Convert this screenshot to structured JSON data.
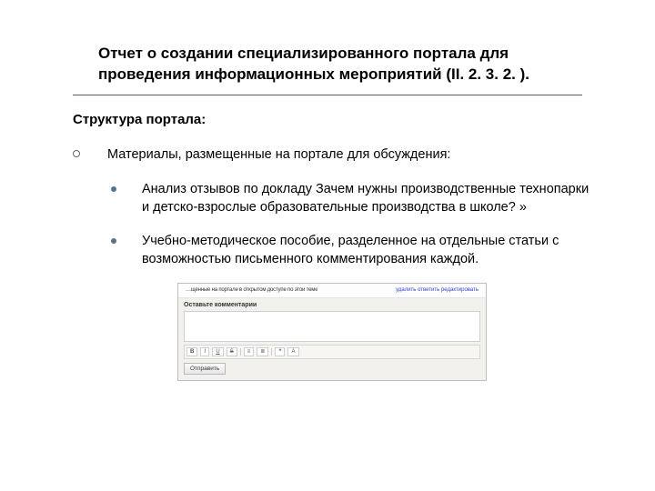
{
  "title": "Отчет о создании специализированного портала для проведения информационных мероприятий (II. 2. 3. 2. ).",
  "subtitle": "Структура портала:",
  "level1_text": "Материалы, размещенные на портале для обсуждения:",
  "bullets": [
    "Анализ отзывов по докладу Зачем нужны производственные технопарки и детско-взрослые образовательные производства в школе? »",
    "Учебно-методическое пособие, разделенное на отдельные статьи с возможностью письменного комментирования каждой."
  ],
  "mini": {
    "header_left_garbled": "…щённые на портале в открытом доступе по этой теме",
    "header_right": "удалить  ответить  редактировать",
    "prompt": "Оставьте комментарии",
    "toolbar": {
      "b": "B",
      "i": "I",
      "u": "U",
      "s": "S",
      "list1": "≡",
      "list2": "≣",
      "q": "❝",
      "clip": "A"
    },
    "submit": "Отправить"
  }
}
